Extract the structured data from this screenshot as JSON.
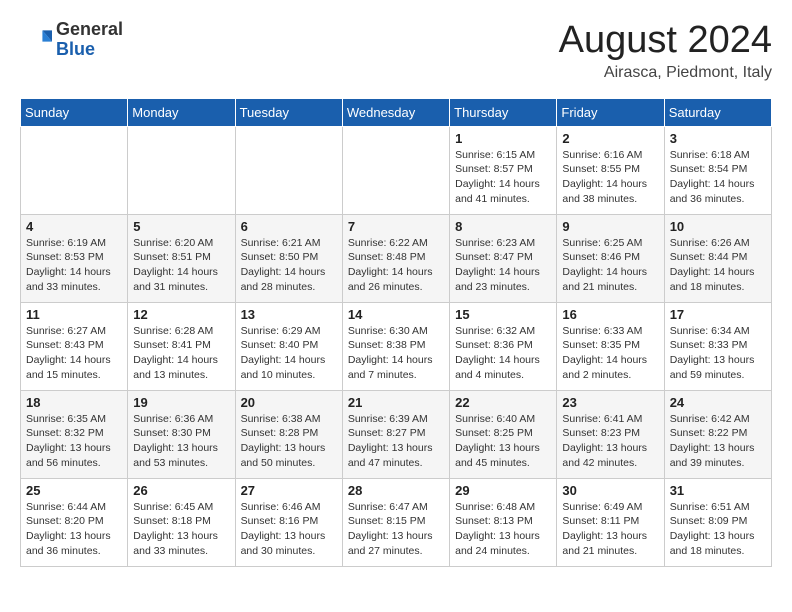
{
  "logo": {
    "general": "General",
    "blue": "Blue"
  },
  "title": "August 2024",
  "location": "Airasca, Piedmont, Italy",
  "days_of_week": [
    "Sunday",
    "Monday",
    "Tuesday",
    "Wednesday",
    "Thursday",
    "Friday",
    "Saturday"
  ],
  "weeks": [
    [
      {
        "day": "",
        "info": ""
      },
      {
        "day": "",
        "info": ""
      },
      {
        "day": "",
        "info": ""
      },
      {
        "day": "",
        "info": ""
      },
      {
        "day": "1",
        "sunrise": "6:15 AM",
        "sunset": "8:57 PM",
        "daylight": "14 hours and 41 minutes."
      },
      {
        "day": "2",
        "sunrise": "6:16 AM",
        "sunset": "8:55 PM",
        "daylight": "14 hours and 38 minutes."
      },
      {
        "day": "3",
        "sunrise": "6:18 AM",
        "sunset": "8:54 PM",
        "daylight": "14 hours and 36 minutes."
      }
    ],
    [
      {
        "day": "4",
        "sunrise": "6:19 AM",
        "sunset": "8:53 PM",
        "daylight": "14 hours and 33 minutes."
      },
      {
        "day": "5",
        "sunrise": "6:20 AM",
        "sunset": "8:51 PM",
        "daylight": "14 hours and 31 minutes."
      },
      {
        "day": "6",
        "sunrise": "6:21 AM",
        "sunset": "8:50 PM",
        "daylight": "14 hours and 28 minutes."
      },
      {
        "day": "7",
        "sunrise": "6:22 AM",
        "sunset": "8:48 PM",
        "daylight": "14 hours and 26 minutes."
      },
      {
        "day": "8",
        "sunrise": "6:23 AM",
        "sunset": "8:47 PM",
        "daylight": "14 hours and 23 minutes."
      },
      {
        "day": "9",
        "sunrise": "6:25 AM",
        "sunset": "8:46 PM",
        "daylight": "14 hours and 21 minutes."
      },
      {
        "day": "10",
        "sunrise": "6:26 AM",
        "sunset": "8:44 PM",
        "daylight": "14 hours and 18 minutes."
      }
    ],
    [
      {
        "day": "11",
        "sunrise": "6:27 AM",
        "sunset": "8:43 PM",
        "daylight": "14 hours and 15 minutes."
      },
      {
        "day": "12",
        "sunrise": "6:28 AM",
        "sunset": "8:41 PM",
        "daylight": "14 hours and 13 minutes."
      },
      {
        "day": "13",
        "sunrise": "6:29 AM",
        "sunset": "8:40 PM",
        "daylight": "14 hours and 10 minutes."
      },
      {
        "day": "14",
        "sunrise": "6:30 AM",
        "sunset": "8:38 PM",
        "daylight": "14 hours and 7 minutes."
      },
      {
        "day": "15",
        "sunrise": "6:32 AM",
        "sunset": "8:36 PM",
        "daylight": "14 hours and 4 minutes."
      },
      {
        "day": "16",
        "sunrise": "6:33 AM",
        "sunset": "8:35 PM",
        "daylight": "14 hours and 2 minutes."
      },
      {
        "day": "17",
        "sunrise": "6:34 AM",
        "sunset": "8:33 PM",
        "daylight": "13 hours and 59 minutes."
      }
    ],
    [
      {
        "day": "18",
        "sunrise": "6:35 AM",
        "sunset": "8:32 PM",
        "daylight": "13 hours and 56 minutes."
      },
      {
        "day": "19",
        "sunrise": "6:36 AM",
        "sunset": "8:30 PM",
        "daylight": "13 hours and 53 minutes."
      },
      {
        "day": "20",
        "sunrise": "6:38 AM",
        "sunset": "8:28 PM",
        "daylight": "13 hours and 50 minutes."
      },
      {
        "day": "21",
        "sunrise": "6:39 AM",
        "sunset": "8:27 PM",
        "daylight": "13 hours and 47 minutes."
      },
      {
        "day": "22",
        "sunrise": "6:40 AM",
        "sunset": "8:25 PM",
        "daylight": "13 hours and 45 minutes."
      },
      {
        "day": "23",
        "sunrise": "6:41 AM",
        "sunset": "8:23 PM",
        "daylight": "13 hours and 42 minutes."
      },
      {
        "day": "24",
        "sunrise": "6:42 AM",
        "sunset": "8:22 PM",
        "daylight": "13 hours and 39 minutes."
      }
    ],
    [
      {
        "day": "25",
        "sunrise": "6:44 AM",
        "sunset": "8:20 PM",
        "daylight": "13 hours and 36 minutes."
      },
      {
        "day": "26",
        "sunrise": "6:45 AM",
        "sunset": "8:18 PM",
        "daylight": "13 hours and 33 minutes."
      },
      {
        "day": "27",
        "sunrise": "6:46 AM",
        "sunset": "8:16 PM",
        "daylight": "13 hours and 30 minutes."
      },
      {
        "day": "28",
        "sunrise": "6:47 AM",
        "sunset": "8:15 PM",
        "daylight": "13 hours and 27 minutes."
      },
      {
        "day": "29",
        "sunrise": "6:48 AM",
        "sunset": "8:13 PM",
        "daylight": "13 hours and 24 minutes."
      },
      {
        "day": "30",
        "sunrise": "6:49 AM",
        "sunset": "8:11 PM",
        "daylight": "13 hours and 21 minutes."
      },
      {
        "day": "31",
        "sunrise": "6:51 AM",
        "sunset": "8:09 PM",
        "daylight": "13 hours and 18 minutes."
      }
    ]
  ]
}
